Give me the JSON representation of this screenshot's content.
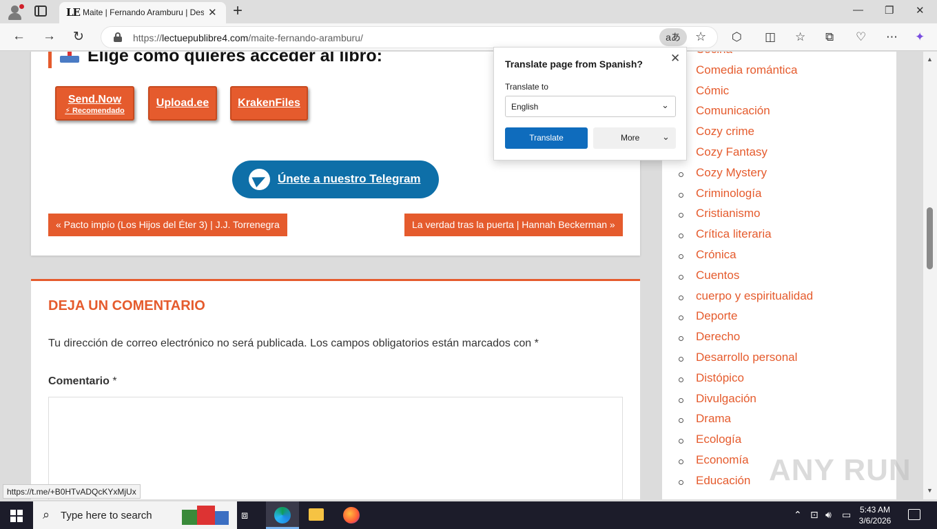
{
  "browser": {
    "tab_title": "Maite | Fernando Aramburu | Descargar",
    "tab_favicon": "LE",
    "url_prefix": "https://",
    "url_host": "lectuepublibre4.com",
    "url_path": "/maite-fernando-aramburu/",
    "translate_glyph": "aあ",
    "status_url": "https://t.me/+B0HTvADQcKYxMjUx"
  },
  "article": {
    "access_title": "Elige cómo quieres acceder al libro:",
    "download_buttons": [
      {
        "label": "Send.Now",
        "sub": "⚡ Recomendado"
      },
      {
        "label": "Upload.ee",
        "sub": ""
      },
      {
        "label": "KrakenFiles",
        "sub": ""
      }
    ],
    "telegram_label": "Únete a nuestro Telegram",
    "prev_post": "« Pacto impío (Los Hijos del Éter 3) | J.J. Torrenegra",
    "next_post": "La verdad tras la puerta | Hannah Beckerman »"
  },
  "comments": {
    "heading": "DEJA UN COMENTARIO",
    "note": "Tu dirección de correo electrónico no será publicada. Los campos obligatorios están marcados con *",
    "label": "Comentario",
    "required_mark": "*"
  },
  "sidebar": {
    "categories": [
      "Cocina",
      "Comedia romántica",
      "Cómic",
      "Comunicación",
      "Cozy crime",
      "Cozy Fantasy",
      "Cozy Mystery",
      "Criminología",
      "Cristianismo",
      "Crítica literaria",
      "Crónica",
      "Cuentos",
      "cuerpo y espiritualidad",
      "Deporte",
      "Derecho",
      "Desarrollo personal",
      "Distópico",
      "Divulgación",
      "Drama",
      "Ecología",
      "Economía",
      "Educación"
    ]
  },
  "translate_popup": {
    "title": "Translate page from Spanish?",
    "translate_to_label": "Translate to",
    "selected_language": "English",
    "translate_button": "Translate",
    "more_button": "More"
  },
  "taskbar": {
    "search_placeholder": "Type here to search",
    "time": "5:43 AM",
    "date": "3/6/2026"
  },
  "watermark": "ANY RUN",
  "colors": {
    "accent": "#e55b2d",
    "telegram": "#0e6fa8",
    "translate_button": "#0f6cbd"
  }
}
